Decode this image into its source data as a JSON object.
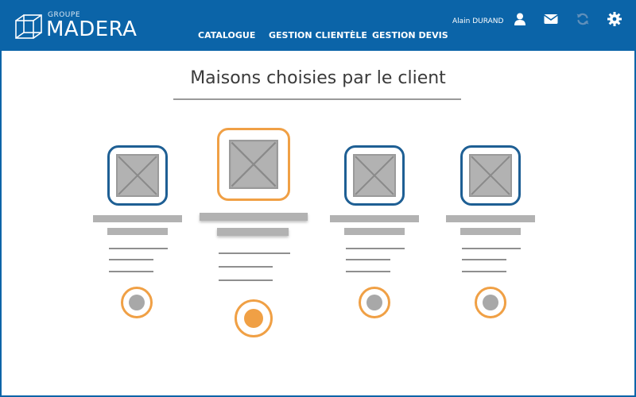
{
  "brand": {
    "group_label": "GROUPE",
    "name": "MADERA"
  },
  "nav": {
    "items": [
      {
        "label": "CATALOGUE"
      },
      {
        "label": "GESTION CLIENTÈLE"
      },
      {
        "label": "GESTION DEVIS"
      }
    ]
  },
  "user": {
    "name": "Alain DURAND"
  },
  "header_icons": [
    "user-icon",
    "mail-icon",
    "sync-icon",
    "gear-icon"
  ],
  "page": {
    "title": "Maisons choisies par le client"
  },
  "houses": [
    {
      "image": "placeholder-image-icon",
      "selected": false
    },
    {
      "image": "placeholder-image-icon",
      "selected": true
    },
    {
      "image": "placeholder-image-icon",
      "selected": false
    },
    {
      "image": "placeholder-image-icon",
      "selected": false
    }
  ],
  "colors": {
    "header_bg": "#0b64a8",
    "accent": "#f0a045",
    "card_border": "#1e5f94",
    "placeholder": "#b2b2b2"
  }
}
